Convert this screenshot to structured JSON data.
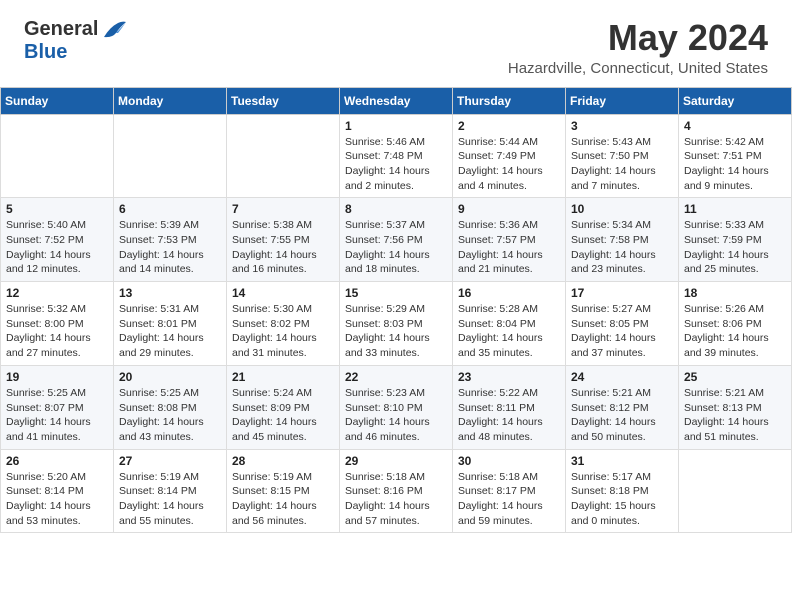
{
  "header": {
    "logo": {
      "general": "General",
      "blue": "Blue"
    },
    "title": "May 2024",
    "subtitle": "Hazardville, Connecticut, United States"
  },
  "calendar": {
    "days_of_week": [
      "Sunday",
      "Monday",
      "Tuesday",
      "Wednesday",
      "Thursday",
      "Friday",
      "Saturday"
    ],
    "weeks": [
      [
        {
          "day": "",
          "info": ""
        },
        {
          "day": "",
          "info": ""
        },
        {
          "day": "",
          "info": ""
        },
        {
          "day": "1",
          "info": "Sunrise: 5:46 AM\nSunset: 7:48 PM\nDaylight: 14 hours\nand 2 minutes."
        },
        {
          "day": "2",
          "info": "Sunrise: 5:44 AM\nSunset: 7:49 PM\nDaylight: 14 hours\nand 4 minutes."
        },
        {
          "day": "3",
          "info": "Sunrise: 5:43 AM\nSunset: 7:50 PM\nDaylight: 14 hours\nand 7 minutes."
        },
        {
          "day": "4",
          "info": "Sunrise: 5:42 AM\nSunset: 7:51 PM\nDaylight: 14 hours\nand 9 minutes."
        }
      ],
      [
        {
          "day": "5",
          "info": "Sunrise: 5:40 AM\nSunset: 7:52 PM\nDaylight: 14 hours\nand 12 minutes."
        },
        {
          "day": "6",
          "info": "Sunrise: 5:39 AM\nSunset: 7:53 PM\nDaylight: 14 hours\nand 14 minutes."
        },
        {
          "day": "7",
          "info": "Sunrise: 5:38 AM\nSunset: 7:55 PM\nDaylight: 14 hours\nand 16 minutes."
        },
        {
          "day": "8",
          "info": "Sunrise: 5:37 AM\nSunset: 7:56 PM\nDaylight: 14 hours\nand 18 minutes."
        },
        {
          "day": "9",
          "info": "Sunrise: 5:36 AM\nSunset: 7:57 PM\nDaylight: 14 hours\nand 21 minutes."
        },
        {
          "day": "10",
          "info": "Sunrise: 5:34 AM\nSunset: 7:58 PM\nDaylight: 14 hours\nand 23 minutes."
        },
        {
          "day": "11",
          "info": "Sunrise: 5:33 AM\nSunset: 7:59 PM\nDaylight: 14 hours\nand 25 minutes."
        }
      ],
      [
        {
          "day": "12",
          "info": "Sunrise: 5:32 AM\nSunset: 8:00 PM\nDaylight: 14 hours\nand 27 minutes."
        },
        {
          "day": "13",
          "info": "Sunrise: 5:31 AM\nSunset: 8:01 PM\nDaylight: 14 hours\nand 29 minutes."
        },
        {
          "day": "14",
          "info": "Sunrise: 5:30 AM\nSunset: 8:02 PM\nDaylight: 14 hours\nand 31 minutes."
        },
        {
          "day": "15",
          "info": "Sunrise: 5:29 AM\nSunset: 8:03 PM\nDaylight: 14 hours\nand 33 minutes."
        },
        {
          "day": "16",
          "info": "Sunrise: 5:28 AM\nSunset: 8:04 PM\nDaylight: 14 hours\nand 35 minutes."
        },
        {
          "day": "17",
          "info": "Sunrise: 5:27 AM\nSunset: 8:05 PM\nDaylight: 14 hours\nand 37 minutes."
        },
        {
          "day": "18",
          "info": "Sunrise: 5:26 AM\nSunset: 8:06 PM\nDaylight: 14 hours\nand 39 minutes."
        }
      ],
      [
        {
          "day": "19",
          "info": "Sunrise: 5:25 AM\nSunset: 8:07 PM\nDaylight: 14 hours\nand 41 minutes."
        },
        {
          "day": "20",
          "info": "Sunrise: 5:25 AM\nSunset: 8:08 PM\nDaylight: 14 hours\nand 43 minutes."
        },
        {
          "day": "21",
          "info": "Sunrise: 5:24 AM\nSunset: 8:09 PM\nDaylight: 14 hours\nand 45 minutes."
        },
        {
          "day": "22",
          "info": "Sunrise: 5:23 AM\nSunset: 8:10 PM\nDaylight: 14 hours\nand 46 minutes."
        },
        {
          "day": "23",
          "info": "Sunrise: 5:22 AM\nSunset: 8:11 PM\nDaylight: 14 hours\nand 48 minutes."
        },
        {
          "day": "24",
          "info": "Sunrise: 5:21 AM\nSunset: 8:12 PM\nDaylight: 14 hours\nand 50 minutes."
        },
        {
          "day": "25",
          "info": "Sunrise: 5:21 AM\nSunset: 8:13 PM\nDaylight: 14 hours\nand 51 minutes."
        }
      ],
      [
        {
          "day": "26",
          "info": "Sunrise: 5:20 AM\nSunset: 8:14 PM\nDaylight: 14 hours\nand 53 minutes."
        },
        {
          "day": "27",
          "info": "Sunrise: 5:19 AM\nSunset: 8:14 PM\nDaylight: 14 hours\nand 55 minutes."
        },
        {
          "day": "28",
          "info": "Sunrise: 5:19 AM\nSunset: 8:15 PM\nDaylight: 14 hours\nand 56 minutes."
        },
        {
          "day": "29",
          "info": "Sunrise: 5:18 AM\nSunset: 8:16 PM\nDaylight: 14 hours\nand 57 minutes."
        },
        {
          "day": "30",
          "info": "Sunrise: 5:18 AM\nSunset: 8:17 PM\nDaylight: 14 hours\nand 59 minutes."
        },
        {
          "day": "31",
          "info": "Sunrise: 5:17 AM\nSunset: 8:18 PM\nDaylight: 15 hours\nand 0 minutes."
        },
        {
          "day": "",
          "info": ""
        }
      ]
    ]
  }
}
